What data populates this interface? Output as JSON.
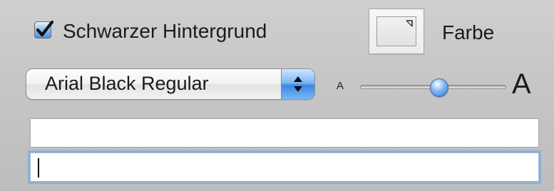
{
  "checkbox": {
    "label": "Schwarzer Hintergrund",
    "checked": true
  },
  "color_well": {
    "label": "Farbe"
  },
  "font_popup": {
    "value": "Arial Black Regular"
  },
  "size_slider": {
    "small_label": "A",
    "large_label": "A",
    "level_fraction": 0.55
  },
  "text_fields": [
    {
      "value": "",
      "focused": false
    },
    {
      "value": "",
      "focused": true
    }
  ],
  "colors": {
    "accent": "#3d87e6",
    "focus_ring": "#69a0e6"
  },
  "icons": {
    "checkbox": "checkmark-icon",
    "popup": "updown-arrows-icon",
    "color_corner": "corner-arrow-icon"
  }
}
